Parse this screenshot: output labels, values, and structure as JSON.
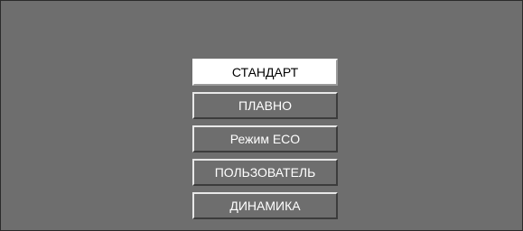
{
  "menu": {
    "selected_index": 0,
    "items": [
      {
        "label": "СТАНДАРТ"
      },
      {
        "label": "ПЛАВНО"
      },
      {
        "label": "Режим ECO"
      },
      {
        "label": "ПОЛЬЗОВАТЕЛЬ"
      },
      {
        "label": "ДИНАМИКА"
      }
    ]
  },
  "colors": {
    "background": "#6e6e6e",
    "selected_background": "#ffffff",
    "text": "#ffffff",
    "selected_text": "#000000"
  }
}
